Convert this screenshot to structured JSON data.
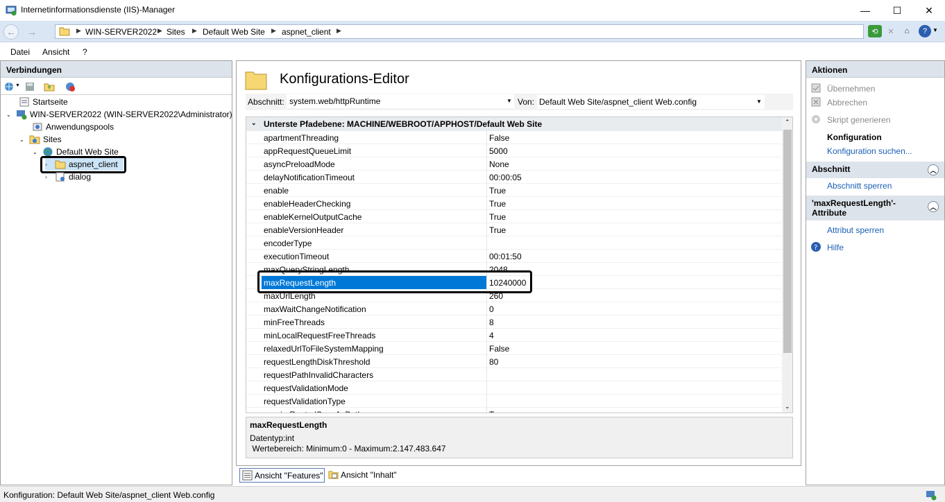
{
  "window": {
    "title": "Internetinformationsdienste (IIS)-Manager",
    "minimize": "—",
    "maximize": "☐",
    "close": "✕"
  },
  "address": {
    "crumbs": [
      "WIN-SERVER2022",
      "Sites",
      "Default Web Site",
      "aspnet_client"
    ]
  },
  "menu": {
    "file": "Datei",
    "view": "Ansicht",
    "help": "?"
  },
  "connections": {
    "header": "Verbindungen",
    "tree": {
      "start": "Startseite",
      "server": "WIN-SERVER2022 (WIN-SERVER2022\\Administrator)",
      "apppools": "Anwendungspools",
      "sites": "Sites",
      "defaultsite": "Default Web Site",
      "aspnet": "aspnet_client",
      "dialog": "dialog"
    }
  },
  "editor": {
    "title": "Konfigurations-Editor",
    "section_label": "Abschnitt:",
    "section_value": "system.web/httpRuntime",
    "from_label": "Von:",
    "from_value": "Default Web Site/aspnet_client Web.config",
    "group_header": "Unterste Pfadebene: MACHINE/WEBROOT/APPHOST/Default Web Site",
    "rows": [
      {
        "k": "apartmentThreading",
        "v": "False"
      },
      {
        "k": "appRequestQueueLimit",
        "v": "5000"
      },
      {
        "k": "asyncPreloadMode",
        "v": "None"
      },
      {
        "k": "delayNotificationTimeout",
        "v": "00:00:05"
      },
      {
        "k": "enable",
        "v": "True"
      },
      {
        "k": "enableHeaderChecking",
        "v": "True"
      },
      {
        "k": "enableKernelOutputCache",
        "v": "True"
      },
      {
        "k": "enableVersionHeader",
        "v": "True"
      },
      {
        "k": "encoderType",
        "v": ""
      },
      {
        "k": "executionTimeout",
        "v": "00:01:50"
      },
      {
        "k": "maxQueryStringLength",
        "v": "2048"
      },
      {
        "k": "maxRequestLength",
        "v": "10240000"
      },
      {
        "k": "maxUrlLength",
        "v": "260"
      },
      {
        "k": "maxWaitChangeNotification",
        "v": "0"
      },
      {
        "k": "minFreeThreads",
        "v": "8"
      },
      {
        "k": "minLocalRequestFreeThreads",
        "v": "4"
      },
      {
        "k": "relaxedUrlToFileSystemMapping",
        "v": "False"
      },
      {
        "k": "requestLengthDiskThreshold",
        "v": "80"
      },
      {
        "k": "requestPathInvalidCharacters",
        "v": ""
      },
      {
        "k": "requestValidationMode",
        "v": ""
      },
      {
        "k": "requestValidationType",
        "v": ""
      },
      {
        "k": "requireRootedSaveAsPath",
        "v": "True"
      }
    ],
    "selected_index": 11,
    "desc_title": "maxRequestLength",
    "desc_type": "Datentyp:int",
    "desc_range": " Wertebereich: Minimum:0 - Maximum:2.147.483.647",
    "view_features": "Ansicht \"Features\"",
    "view_content": "Ansicht \"Inhalt\""
  },
  "actions": {
    "header": "Aktionen",
    "apply": "Übernehmen",
    "cancel": "Abbrechen",
    "script": "Skript generieren",
    "config_title": "Konfiguration",
    "config_search": "Konfiguration suchen...",
    "section_head": "Abschnitt",
    "section_lock": "Abschnitt sperren",
    "attr_head": "'maxRequestLength'-Attribute",
    "attr_lock": "Attribut sperren",
    "help": "Hilfe"
  },
  "status": "Konfiguration: Default Web Site/aspnet_client Web.config"
}
